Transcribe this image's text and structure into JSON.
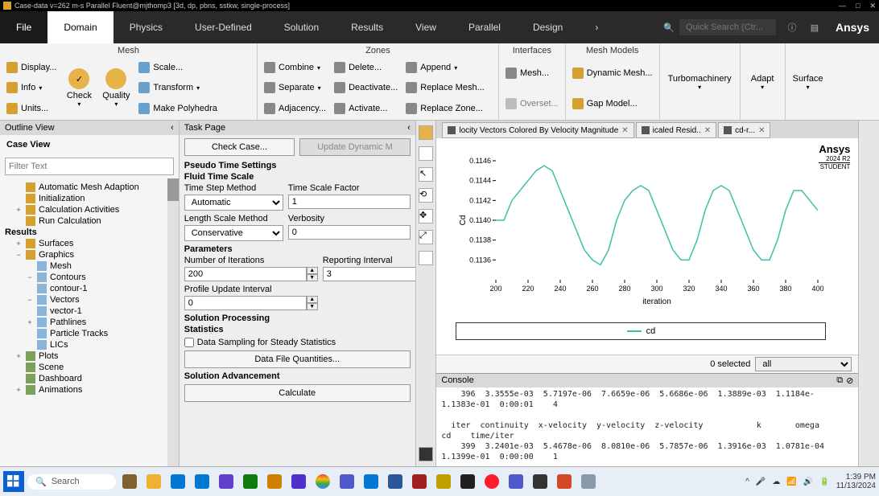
{
  "window": {
    "title": "Case-data v=262 m-s Parallel Fluent@mjthomp3  [3d, dp, pbns, sstkw, single-process]"
  },
  "ribbon_tabs": [
    "File",
    "Domain",
    "Physics",
    "User-Defined",
    "Solution",
    "Results",
    "View",
    "Parallel",
    "Design"
  ],
  "active_tab": "Domain",
  "search_placeholder": "Quick Search (Ctr...",
  "brand": "Ansys",
  "ribbon": {
    "mesh": {
      "title": "Mesh",
      "display": "Display...",
      "info": "Info",
      "units": "Units...",
      "check": "Check",
      "quality": "Quality",
      "scale": "Scale...",
      "transform": "Transform",
      "makepoly": "Make Polyhedra"
    },
    "zones": {
      "title": "Zones",
      "combine": "Combine",
      "separate": "Separate",
      "adjacency": "Adjacency...",
      "delete": "Delete...",
      "deactivate": "Deactivate...",
      "activate": "Activate...",
      "append": "Append",
      "replacemesh": "Replace Mesh...",
      "replacezone": "Replace Zone..."
    },
    "interfaces": {
      "title": "Interfaces",
      "mesh": "Mesh...",
      "overset": "Overset..."
    },
    "meshmodels": {
      "title": "Mesh Models",
      "dynmesh": "Dynamic Mesh...",
      "gap": "Gap Model..."
    },
    "turbo": "Turbomachinery",
    "adapt": "Adapt",
    "surface": "Surface"
  },
  "outline": {
    "title": "Outline View",
    "case_view": "Case View",
    "filter_placeholder": "Filter Text",
    "items": {
      "auto_mesh": "Automatic Mesh Adaption",
      "init": "Initialization",
      "calc_act": "Calculation Activities",
      "run_calc": "Run Calculation",
      "results": "Results",
      "surfaces": "Surfaces",
      "graphics": "Graphics",
      "mesh": "Mesh",
      "contours": "Contours",
      "contour1": "contour-1",
      "vectors": "Vectors",
      "vector1": "vector-1",
      "pathlines": "Pathlines",
      "ptracks": "Particle Tracks",
      "lics": "LICs",
      "plots": "Plots",
      "scene": "Scene",
      "dashboard": "Dashboard",
      "animations": "Animations"
    }
  },
  "task": {
    "title": "Task Page",
    "check_case": "Check Case...",
    "update_dyn": "Update Dynamic M",
    "pseudo": "Pseudo Time Settings",
    "fluid_ts": "Fluid Time Scale",
    "ts_method_l": "Time Step Method",
    "ts_method_v": "Automatic",
    "ts_factor_l": "Time Scale Factor",
    "ts_factor_v": "1",
    "ls_method_l": "Length Scale Method",
    "ls_method_v": "Conservative",
    "verb_l": "Verbosity",
    "verb_v": "0",
    "params": "Parameters",
    "niter_l": "Number of Iterations",
    "niter_v": "200",
    "rint_l": "Reporting Interval",
    "rint_v": "3",
    "pupd_l": "Profile Update Interval",
    "pupd_v": "0",
    "solproc": "Solution Processing",
    "stats": "Statistics",
    "datasamp": "Data Sampling for Steady Statistics",
    "dfq": "Data File Quantities...",
    "soladv": "Solution Advancement",
    "calc": "Calculate"
  },
  "graphics": {
    "tabs": [
      "locity Vectors Colored By Velocity Magnitude",
      "icaled Resid..",
      "cd-r..."
    ],
    "logo": "Ansys",
    "logo_sub": "2024 R2",
    "logo_sub2": "STUDENT",
    "ylabel": "Cd",
    "xlabel": "iteration",
    "legend": "cd",
    "selected_text": "0 selected",
    "selector": "all"
  },
  "chart_data": {
    "type": "line",
    "title": "",
    "xlabel": "iteration",
    "ylabel": "Cd",
    "xlim": [
      200,
      400
    ],
    "ylim": [
      0.1134,
      0.1146
    ],
    "xticks": [
      200,
      220,
      240,
      260,
      280,
      300,
      320,
      340,
      360,
      380,
      400
    ],
    "yticks": [
      0.1136,
      0.1138,
      0.114,
      0.1142,
      0.1144,
      0.1146
    ],
    "series": [
      {
        "name": "cd",
        "x": [
          200,
          205,
          210,
          215,
          220,
          225,
          230,
          235,
          240,
          245,
          250,
          255,
          260,
          265,
          270,
          275,
          280,
          285,
          290,
          295,
          300,
          305,
          310,
          315,
          320,
          325,
          330,
          335,
          340,
          345,
          350,
          355,
          360,
          365,
          370,
          375,
          380,
          385,
          390,
          395,
          400
        ],
        "y": [
          0.114,
          0.114,
          0.1142,
          0.1143,
          0.1144,
          0.1145,
          0.11455,
          0.1145,
          0.1143,
          0.1141,
          0.1139,
          0.1137,
          0.1136,
          0.11355,
          0.1137,
          0.114,
          0.1142,
          0.1143,
          0.11435,
          0.1143,
          0.1141,
          0.1139,
          0.1137,
          0.1136,
          0.1136,
          0.1138,
          0.1141,
          0.1143,
          0.11435,
          0.1143,
          0.1141,
          0.1139,
          0.1137,
          0.1136,
          0.1136,
          0.1138,
          0.1141,
          0.1143,
          0.1143,
          0.1142,
          0.1141
        ]
      }
    ]
  },
  "console": {
    "title": "Console",
    "text": "    396  3.3555e-03  5.7197e-06  7.6659e-06  5.6686e-06  1.3889e-03  1.1184e-\n1.1383e-01  0:00:01    4\n\n  iter  continuity  x-velocity  y-velocity  z-velocity           k       omega\ncd    time/iter\n    399  3.2401e-03  5.4678e-06  8.0810e-06  5.7857e-06  1.3916e-03  1.0781e-04\n1.1399e-01  0:00:00    1"
  },
  "taskbar": {
    "search": "Search",
    "time": "1:39 PM",
    "date": "11/13/2024"
  }
}
